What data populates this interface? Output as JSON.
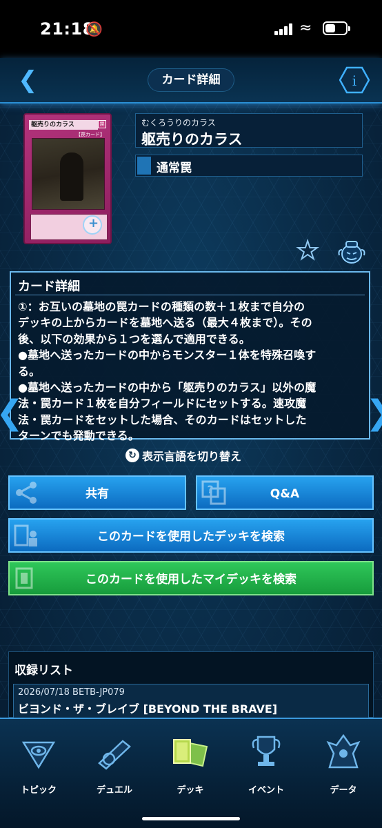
{
  "status": {
    "time": "21:18"
  },
  "header": {
    "title": "カード詳細"
  },
  "card": {
    "ruby": "むくろうりのカラス",
    "name": "躯売りのカラス",
    "type": "通常罠",
    "image_title": "躯売りのカラス",
    "image_icon": "罠",
    "image_type": "【罠カード】"
  },
  "details": {
    "heading": "カード詳細",
    "lines": [
      "①：お互いの墓地の罠カードの種類の数＋１枚まで自分の",
      "デッキの上からカードを墓地へ送る（最大４枚まで）。その",
      "後、以下の効果から１つを選んで適用できる。",
      "●墓地へ送ったカードの中からモンスター１体を特殊召喚す",
      "る。",
      "●墓地へ送ったカードの中から「躯売りのカラス」以外の魔",
      "法・罠カード１枚を自分フィールドにセットする。速攻魔",
      "法・罠カードをセットした場合、そのカードはセットした",
      "ターンでも発動できる。"
    ]
  },
  "switch_language": "表示言語を切り替え",
  "buttons": {
    "share": "共有",
    "qa": "Q&A",
    "search_deck": "このカードを使用したデッキを検索",
    "search_mydeck": "このカードを使用したマイデッキを検索"
  },
  "list": {
    "heading": "収録リスト",
    "items": [
      {
        "meta": "2026/07/18   BETB-JP079",
        "name": "ビヨンド・ザ・ブレイブ [BEYOND THE BRAVE]"
      }
    ]
  },
  "nav": {
    "topic": "トピック",
    "duel": "デュエル",
    "deck": "デッキ",
    "event": "イベント",
    "data": "データ"
  },
  "colors": {
    "accent": "#36a6f2",
    "button_blue": "#1a86d8",
    "button_green": "#22b34a",
    "trap": "#b3337c"
  }
}
